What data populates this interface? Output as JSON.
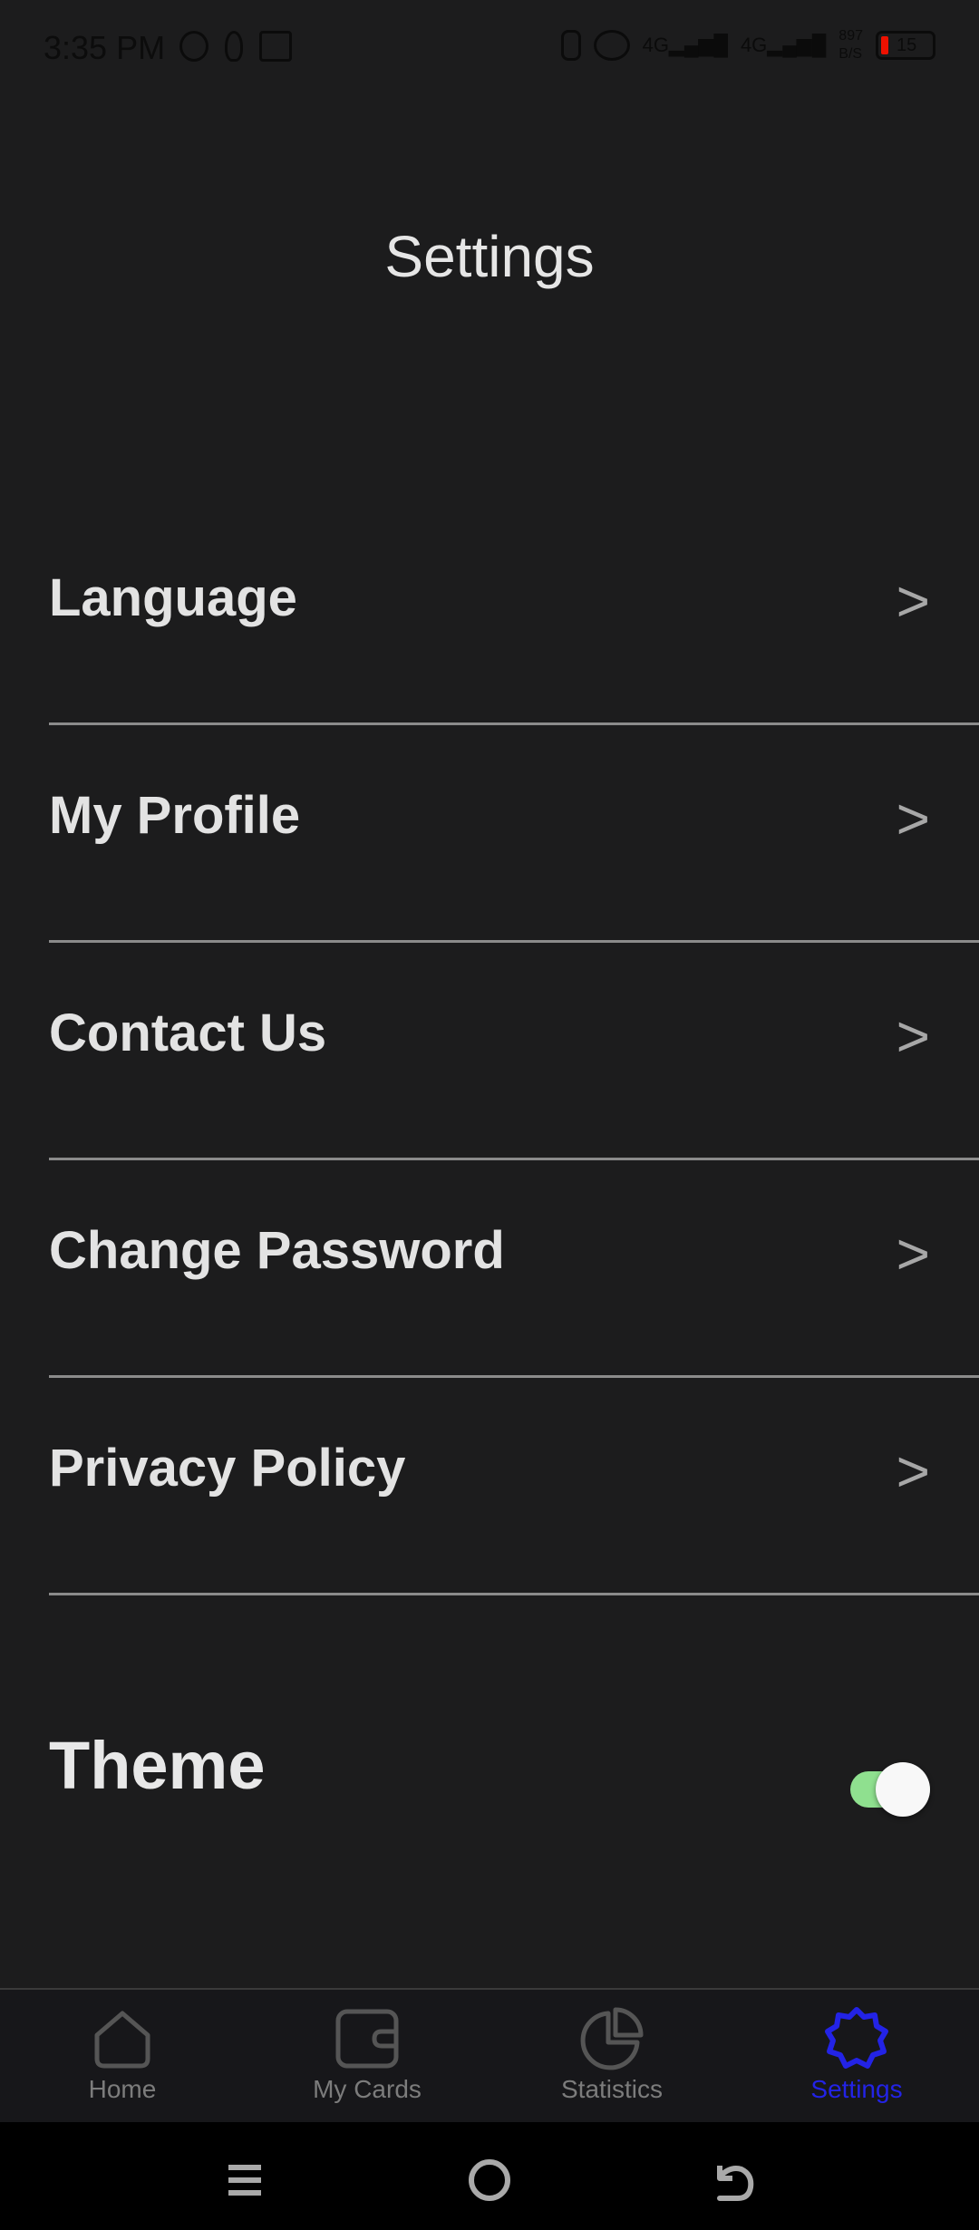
{
  "status_bar": {
    "time": "3:35 PM",
    "left_icons": [
      "whatsapp-icon",
      "flame-icon",
      "gmail-icon"
    ],
    "right_icons": [
      "vibrate-icon",
      "hotspot-icon",
      "signal-4g-icon",
      "signal-4g-icon"
    ],
    "net_speed": "897\nB/S",
    "battery": "15",
    "battery_color": "#ee1100"
  },
  "page": {
    "title": "Settings"
  },
  "settings": {
    "items": [
      {
        "label": "Language",
        "chevron": ">"
      },
      {
        "label": "My Profile",
        "chevron": ">"
      },
      {
        "label": "Contact Us",
        "chevron": ">"
      },
      {
        "label": "Change Password",
        "chevron": ">"
      },
      {
        "label": "Privacy Policy",
        "chevron": ">"
      }
    ],
    "theme": {
      "label": "Theme",
      "enabled": true,
      "toggle_color": "#8fe08f"
    }
  },
  "bottom_nav": {
    "active_color": "#2323e6",
    "items": [
      {
        "label": "Home",
        "icon": "home-icon",
        "active": false
      },
      {
        "label": "My Cards",
        "icon": "wallet-icon",
        "active": false
      },
      {
        "label": "Statistics",
        "icon": "pie-chart-icon",
        "active": false
      },
      {
        "label": "Settings",
        "icon": "gear-icon",
        "active": true
      }
    ]
  },
  "system_nav": {
    "icons": [
      "recents-icon",
      "home-circle-icon",
      "back-icon"
    ]
  }
}
